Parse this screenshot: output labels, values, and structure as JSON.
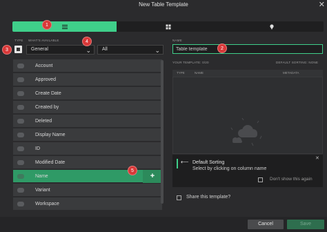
{
  "window": {
    "title": "New Table Template"
  },
  "view_toggle": {
    "options": [
      "list-icon",
      "grid-icon",
      "map-pin-icon"
    ],
    "active": "list"
  },
  "badges": [
    "1",
    "2",
    "3",
    "4",
    "5"
  ],
  "filters": {
    "type_label": "TYPE",
    "whats_available_label": "WHAT'S AVAILABLE",
    "category_value": "General",
    "second_value": "All"
  },
  "template": {
    "name_label": "NAME",
    "name_value": "Table template",
    "your_template_label": "YOUR TEMPLATE: 0/20",
    "default_sorting_label": "DEFAULT SORTING: NONE",
    "columns": [
      "TYPE",
      "NAME",
      "METADATA"
    ]
  },
  "fields": [
    "Account",
    "Approved",
    "Create Date",
    "Created by",
    "Deleted",
    "Display Name",
    "ID",
    "Modified Date",
    "Name",
    "Variant",
    "Workspace"
  ],
  "selected_field_index": 8,
  "toast": {
    "title": "Default Sorting",
    "message": "Select by clicking on column name",
    "dont_show": "Don't show this again"
  },
  "share_label": "Share this template?",
  "buttons": {
    "cancel": "Cancel",
    "save": "Save"
  },
  "colors": {
    "accent": "#3fcf8a",
    "badge": "#d93838"
  }
}
